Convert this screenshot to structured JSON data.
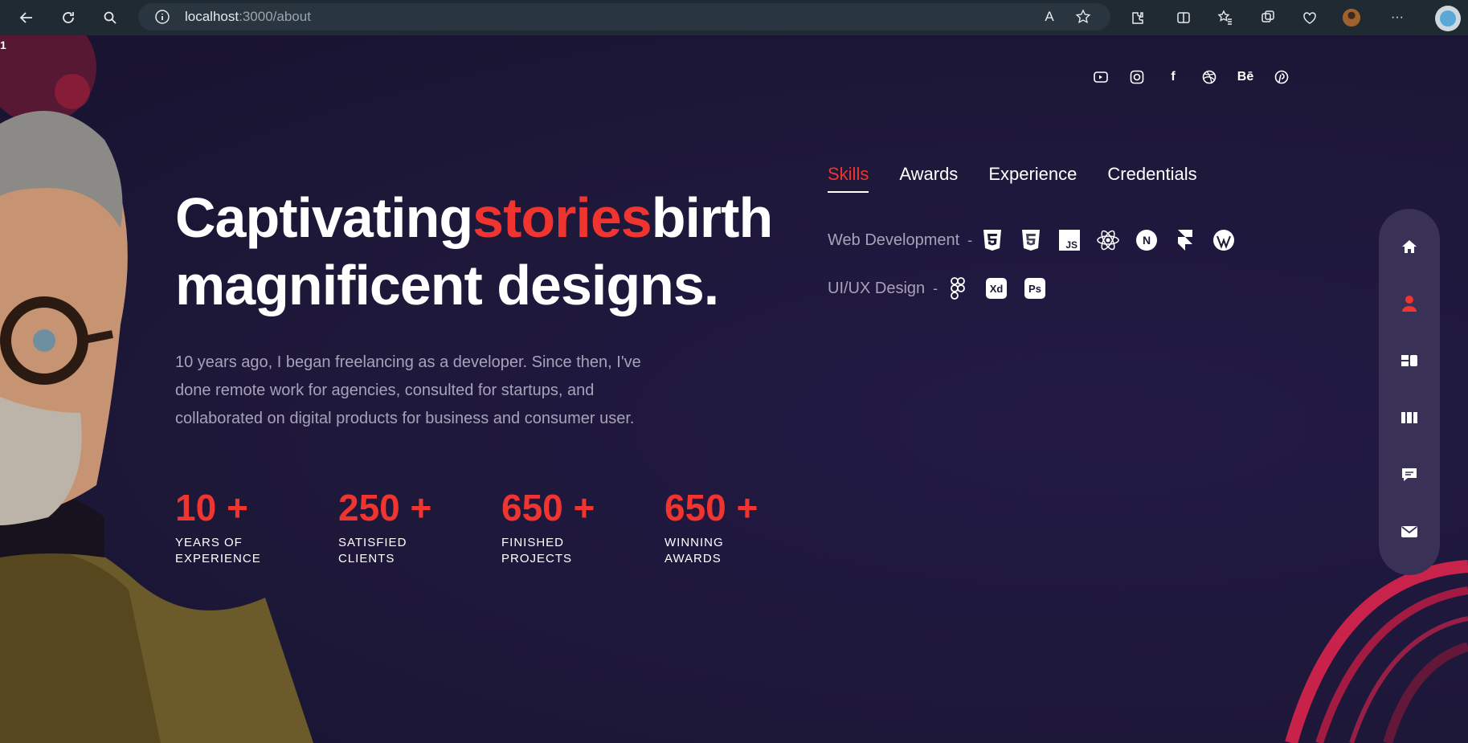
{
  "browser": {
    "url_host": "localhost",
    "url_path": ":3000/about",
    "read_aloud_label": "A",
    "more_label": "···"
  },
  "page": {
    "corner_number": "1",
    "socials": {
      "behance": "Bē",
      "facebook": "f"
    },
    "headline": {
      "word1": "Captivating",
      "accent": "stories",
      "word2": "birth",
      "line2": "magnificent designs."
    },
    "bio": "10 years ago, I began freelancing as a developer. Since then, I've done remote work for agencies, consulted for startups, and collaborated on digital products for business and consumer user.",
    "stats": [
      {
        "number": "10 +",
        "label": "YEARS OF EXPERIENCE"
      },
      {
        "number": "250 +",
        "label": "SATISFIED CLIENTS"
      },
      {
        "number": "650 +",
        "label": "FINISHED PROJECTS"
      },
      {
        "number": "650 +",
        "label": "WINNING AWARDS"
      }
    ],
    "tabs": [
      {
        "label": "Skills",
        "active": true
      },
      {
        "label": "Awards"
      },
      {
        "label": "Experience"
      },
      {
        "label": "Credentials"
      }
    ],
    "skills": [
      {
        "label": "Web Development",
        "dash": "-",
        "icons": [
          "html5-icon",
          "css3-icon",
          "javascript-icon",
          "react-icon",
          "nextjs-icon",
          "framer-icon",
          "wordpress-icon"
        ]
      },
      {
        "label": "UI/UX Design",
        "dash": "-",
        "icons": [
          "figma-icon",
          "adobe-xd-icon",
          "photoshop-icon"
        ]
      }
    ],
    "icon_text": {
      "js": "JS",
      "next": "N",
      "xd": "Xd",
      "ps": "Ps"
    },
    "nav": [
      "home-icon",
      "user-icon",
      "work-icon",
      "testimonials-icon",
      "chat-icon",
      "mail-icon"
    ],
    "colors": {
      "accent": "#f0342f",
      "background": "#1e1838",
      "nav_bg": "#3a3156"
    }
  }
}
